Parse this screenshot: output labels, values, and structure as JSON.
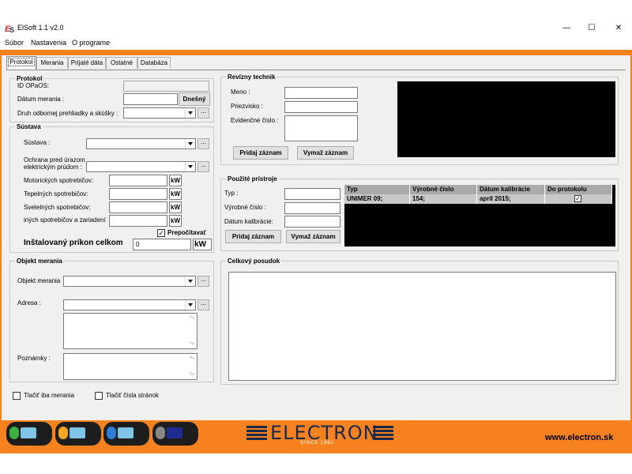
{
  "window": {
    "title": "ElSoft 1.1 v2.0",
    "minimize": "—",
    "maximize": "☐",
    "close": "✕"
  },
  "menu": [
    "Súbor",
    "Nastavenia",
    "O programe"
  ],
  "tabs": [
    "Protokol",
    "Merania",
    "Prijaté dáta",
    "Ostatné",
    "Databáza"
  ],
  "protokol": {
    "title": "Protokol",
    "id_label": "ID OPaOS:",
    "datum_label": "Dátum merania :",
    "dnesny": "Dnešný",
    "druh_label": "Druh odbornej prehliadky a skúšky :",
    "dots": "..."
  },
  "sustava": {
    "title": "Sústava",
    "sustava_label": "Sústava :",
    "ochrana_label1": "Ochrana pred úrazom",
    "ochrana_label2": "elektrickým prúdom :",
    "motor_label": "Motorických spotrebičov:",
    "tepel_label": "Tepelných spotrebičov:",
    "svetel_label": "Svetelných spotrebičov:",
    "inych_label": "iných spotrebičov a zariadení",
    "unit": "kW",
    "prepocitavat": "Prepočítavať",
    "prepocitavat_checked": "✓",
    "instal_label": "Inštalovaný príkon celkom",
    "instal_value": "0",
    "instal_unit": "kW"
  },
  "revizny": {
    "title": "Revízny technik",
    "meno": "Meno :",
    "priezvisko": "Priezvisko :",
    "evidencne": "Evidenčné číslo :",
    "pridaj": "Pridaj záznam",
    "vymaz": "Vymaž záznam"
  },
  "pristroje": {
    "title": "Použité prístroje",
    "typ": "Typ :",
    "vyrobne": "Výrobné číslo :",
    "datum_kal": "Dátum kalibrácie:",
    "pridaj": "Pridaj záznam",
    "vymaz": "Vymaž záznam",
    "grid_headers": [
      "Typ",
      "Výrobné číslo",
      "Dátum kalibrácie",
      "Do protokolu"
    ],
    "grid_rows": [
      [
        "UNIMER 09;",
        "154;",
        "apríl 2015;",
        "✓"
      ]
    ]
  },
  "objekt": {
    "title": "Objekt merania",
    "objekt_label": "Objekt merania",
    "adresa_label": "Adresa :",
    "poznamky_label": "Poznámky :"
  },
  "posudok": {
    "title": "Celkový posudok"
  },
  "print_options": {
    "iba_merania": "Tlačiť iba merania",
    "cisla_stranok": "Tlačiť čísla stránok"
  },
  "footer": {
    "brand": "ELECTRON",
    "since": "SINCE 1992",
    "website": "www.electron.sk"
  },
  "colors": {
    "accent": "#f5821f",
    "brand_navy": "#1c2a4a"
  }
}
